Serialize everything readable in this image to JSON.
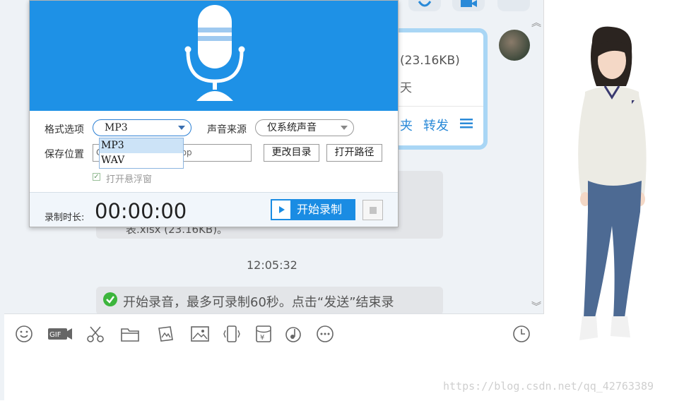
{
  "chat": {
    "file_size": "(23.16KB)",
    "file_days": "天",
    "file_action_open_folder": "夹",
    "file_action_forward": "转发",
    "partial_message": "表.xlsx  (23.16KB)。",
    "timestamp": "12:05:32",
    "record_notice": "开始录音，最多可录制60秒。点击“发送”结束录"
  },
  "recorder": {
    "format_label": "格式选项",
    "format_selected": "MP3",
    "format_options": [
      "MP3",
      "WAV"
    ],
    "source_label": "声音来源",
    "source_selected": "仅系统声音",
    "save_label": "保存位置",
    "save_path": "top",
    "save_path_prefix": "C",
    "change_dir_button": "更改目录",
    "open_path_button": "打开路径",
    "float_window_checkbox": "打开悬浮窗",
    "float_window_checked": true,
    "duration_label": "录制时长:",
    "duration_value": "00:00:00",
    "start_button": "开始录制",
    "header_color": "#1e91e6"
  },
  "toolbar": {
    "icons": [
      "emoji-icon",
      "gif-icon",
      "scissors-icon",
      "folder-icon",
      "image-edit-icon",
      "image-icon",
      "shake-icon",
      "red-packet-icon",
      "music-icon",
      "more-icon",
      "history-clock-icon"
    ]
  },
  "watermark": "https://blog.csdn.net/qq_42763389",
  "colors": {
    "accent": "#1e91e6",
    "link": "#2a8ad8",
    "success": "#3cb53c"
  }
}
